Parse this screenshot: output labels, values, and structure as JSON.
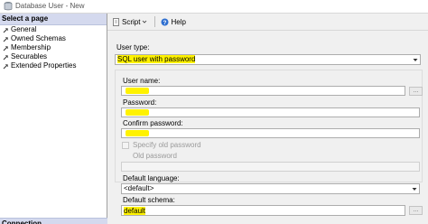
{
  "window": {
    "title": "Database User - New"
  },
  "left_pane": {
    "header": "Select a page",
    "pages": [
      "General",
      "Owned Schemas",
      "Membership",
      "Securables",
      "Extended Properties"
    ],
    "bottom_header": "Connection"
  },
  "toolbar": {
    "script_label": "Script",
    "help_label": "Help"
  },
  "form": {
    "user_type_label": "User type:",
    "user_type_value": "SQL user with password",
    "user_name_label": "User name:",
    "password_label": "Password:",
    "confirm_password_label": "Confirm password:",
    "specify_old_password_label": "Specify old password",
    "old_password_label": "Old password",
    "default_language_label": "Default language:",
    "default_language_value": "<default>",
    "default_schema_label": "Default schema:",
    "default_schema_value": "default",
    "ellipsis": "..."
  },
  "colors": {
    "highlight": "#fff200",
    "selection_header": "#d4d9ee"
  }
}
